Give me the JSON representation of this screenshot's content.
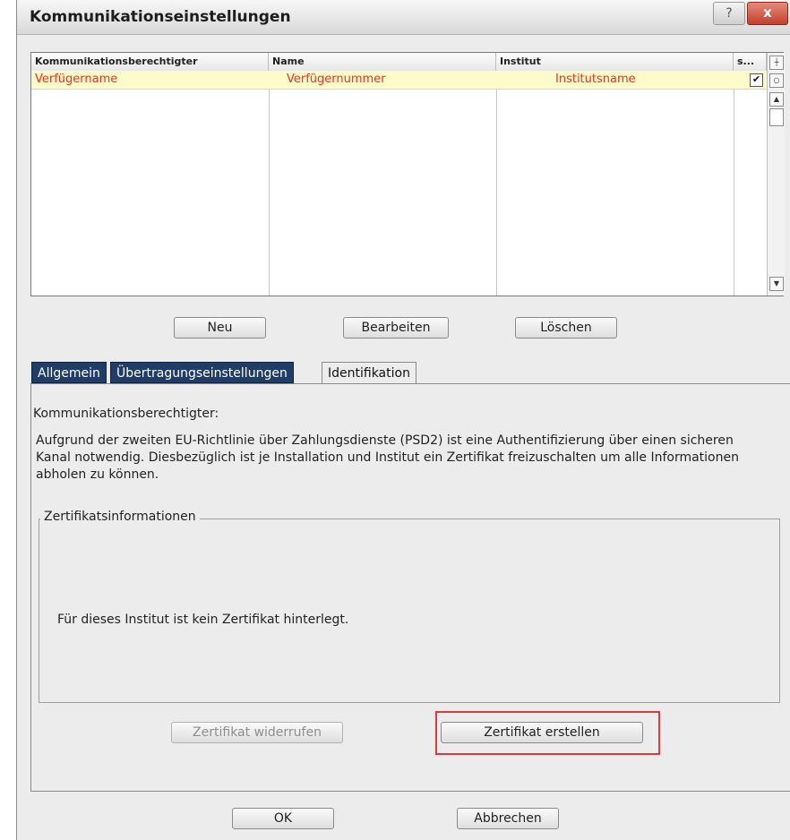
{
  "window": {
    "title": "Kommunikationseinstellungen",
    "help_label": "?",
    "close_label": "x"
  },
  "list": {
    "columns": [
      "Kommunikationsberechtigter",
      "Name",
      "Institut",
      "s..."
    ],
    "rows": [
      {
        "kommunikationsberechtigter": "Verfügername",
        "name": "Verfügernummer",
        "institut": "Institutsname",
        "checked": "✔"
      }
    ]
  },
  "list_buttons": {
    "new": "Neu",
    "edit": "Bearbeiten",
    "delete": "Löschen"
  },
  "tabs": [
    {
      "label": "Allgemein"
    },
    {
      "label": "Übertragungseinstellungen"
    },
    {
      "label": "Identifikation"
    }
  ],
  "identification": {
    "label": "Kommunikationsberechtigter:",
    "description": "Aufgrund der zweiten EU-Richtlinie über Zahlungsdienste (PSD2) ist eine Authentifizierung über einen sicheren Kanal notwendig. Diesbezüglich ist je Installation und Institut ein Zertifikat freizuschalten um alle Informationen abholen zu können.",
    "group_title": "Zertifikatsinformationen",
    "no_certificate": "Für dieses Institut ist kein Zertifikat hinterlegt.",
    "revoke_button": "Zertifikat widerrufen",
    "create_button": "Zertifikat erstellen"
  },
  "footer": {
    "ok": "OK",
    "cancel": "Abbrechen"
  },
  "colors": {
    "row_text": "#ff2a1e",
    "row_bg": "#fdfbc9",
    "tab_dark": "#1f3d66",
    "highlight": "#e0393b"
  }
}
